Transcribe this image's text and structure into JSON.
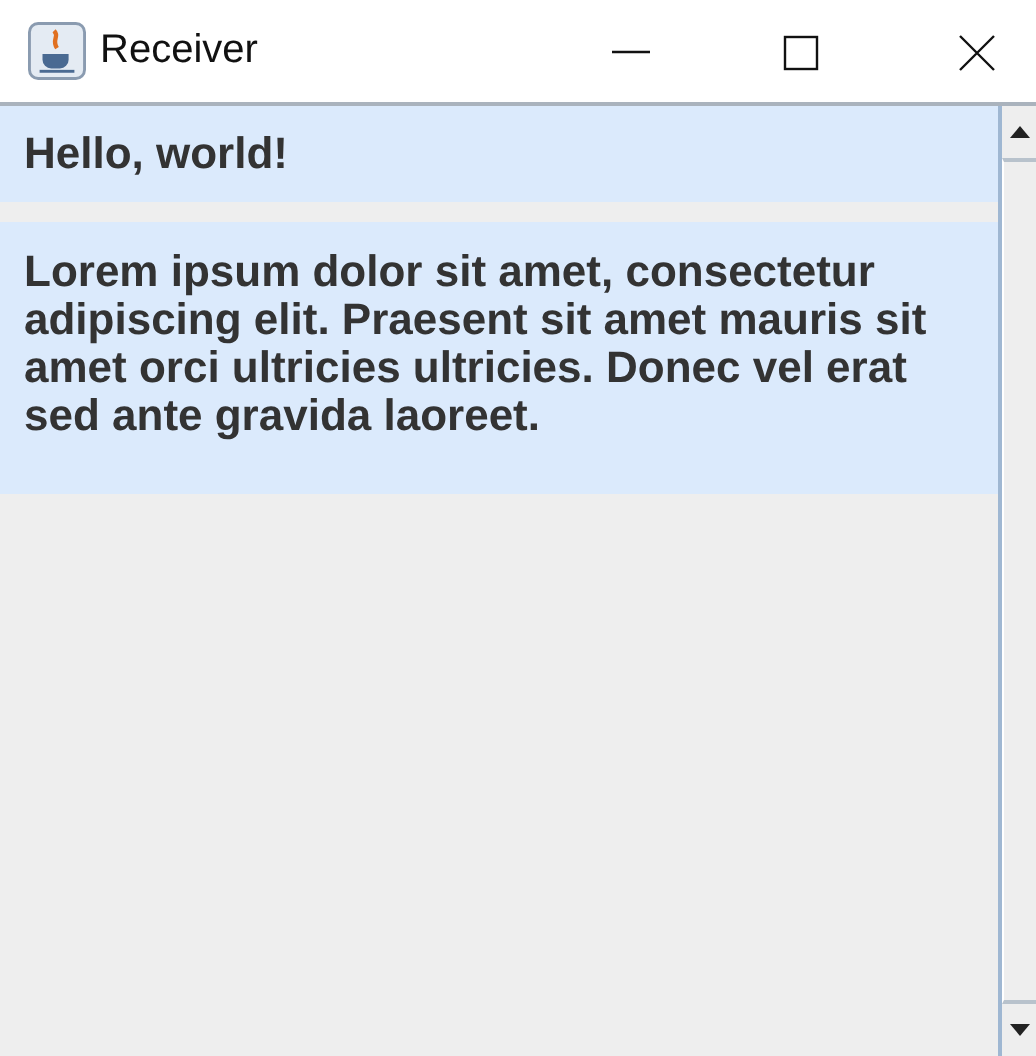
{
  "window": {
    "title": "Receiver"
  },
  "messages": [
    {
      "text": "Hello, world!"
    },
    {
      "text": "Lorem ipsum dolor sit amet, consectetur adipiscing elit. Praesent sit amet mauris sit amet orci ultricies ultricies. Donec vel erat sed ante gravida laoreet."
    }
  ]
}
